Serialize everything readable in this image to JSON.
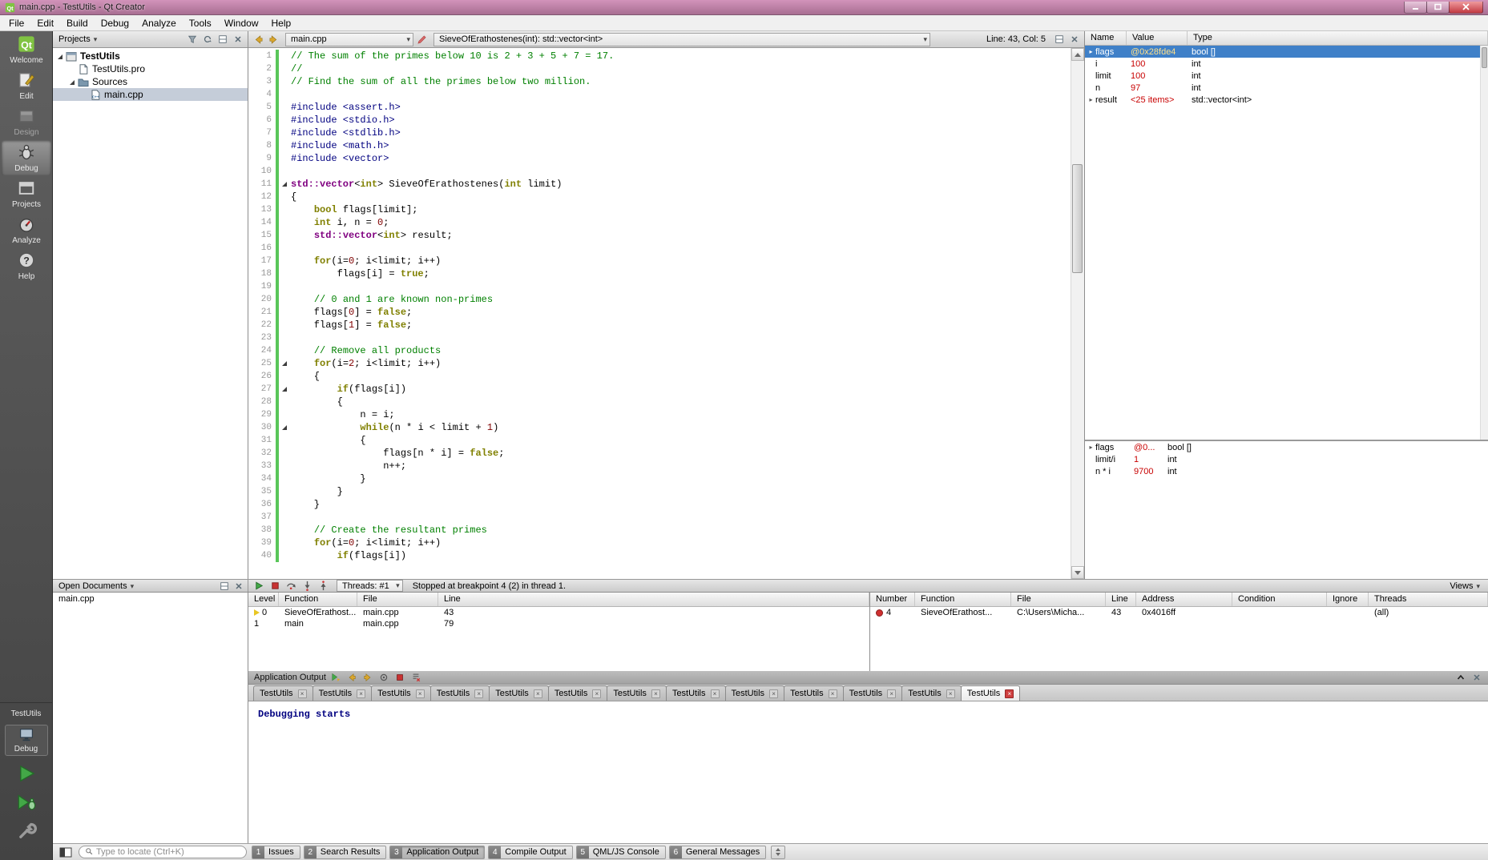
{
  "window": {
    "title": "main.cpp - TestUtils - Qt Creator"
  },
  "menubar": [
    "File",
    "Edit",
    "Build",
    "Debug",
    "Analyze",
    "Tools",
    "Window",
    "Help"
  ],
  "mode_sidebar": {
    "modes": [
      {
        "label": "Welcome",
        "icon": "qtlogo",
        "active": false,
        "disabled": false
      },
      {
        "label": "Edit",
        "icon": "edit",
        "active": false,
        "disabled": false
      },
      {
        "label": "Design",
        "icon": "design",
        "active": false,
        "disabled": true
      },
      {
        "label": "Debug",
        "icon": "debug",
        "active": true,
        "disabled": false
      },
      {
        "label": "Projects",
        "icon": "projects",
        "active": false,
        "disabled": false
      },
      {
        "label": "Analyze",
        "icon": "analyze",
        "active": false,
        "disabled": false
      },
      {
        "label": "Help",
        "icon": "help",
        "active": false,
        "disabled": false
      }
    ],
    "target_name": "TestUtils",
    "build_config": "Debug"
  },
  "projects_panel": {
    "title": "Projects",
    "tree": [
      {
        "label": "TestUtils",
        "depth": 0,
        "bold": true,
        "expanded": true,
        "icon": "project",
        "selected": false
      },
      {
        "label": "TestUtils.pro",
        "depth": 1,
        "icon": "profile",
        "selected": false
      },
      {
        "label": "Sources",
        "depth": 1,
        "expanded": true,
        "icon": "folder",
        "selected": false
      },
      {
        "label": "main.cpp",
        "depth": 2,
        "icon": "cppfile",
        "selected": true
      }
    ]
  },
  "editor": {
    "file_combo": "main.cpp",
    "symbol_combo": "SieveOfErathostenes(int): std::vector<int>",
    "line_col": "Line: 43, Col: 5",
    "fold_lines": [
      11,
      25,
      27,
      30
    ],
    "code_lines": [
      "// The sum of the primes below 10 is 2 + 3 + 5 + 7 = 17.",
      "//",
      "// Find the sum of all the primes below two million.",
      "",
      "#include <assert.h>",
      "#include <stdio.h>",
      "#include <stdlib.h>",
      "#include <math.h>",
      "#include <vector>",
      "",
      "std::vector<int> SieveOfErathostenes(int limit)",
      "{",
      "    bool flags[limit];",
      "    int i, n = 0;",
      "    std::vector<int> result;",
      "",
      "    for(i=0; i<limit; i++)",
      "        flags[i] = true;",
      "",
      "    // 0 and 1 are known non-primes",
      "    flags[0] = false;",
      "    flags[1] = false;",
      "",
      "    // Remove all products",
      "    for(i=2; i<limit; i++)",
      "    {",
      "        if(flags[i])",
      "        {",
      "            n = i;",
      "            while(n * i < limit + 1)",
      "            {",
      "                flags[n * i] = false;",
      "                n++;",
      "            }",
      "        }",
      "    }",
      "",
      "    // Create the resultant primes",
      "    for(i=0; i<limit; i++)",
      "        if(flags[i])"
    ]
  },
  "locals_pane": {
    "columns": [
      "Name",
      "Value",
      "Type"
    ],
    "rows": [
      {
        "name": "flags",
        "value": "@0x28fde4",
        "type": "bool []",
        "selected": true,
        "expandable": true
      },
      {
        "name": "i",
        "value": "100",
        "type": "int",
        "selected": false,
        "expandable": false
      },
      {
        "name": "limit",
        "value": "100",
        "type": "int",
        "selected": false,
        "expandable": false
      },
      {
        "name": "n",
        "value": "97",
        "type": "int",
        "selected": false,
        "expandable": false
      },
      {
        "name": "result",
        "value": "<25 items>",
        "type": "std::vector<int>",
        "selected": false,
        "expandable": true
      }
    ]
  },
  "watch_pane": {
    "rows": [
      {
        "name": "flags",
        "value": "@0...",
        "type": "bool []",
        "selected": false,
        "expandable": true
      },
      {
        "name": "limit/i",
        "value": "1",
        "type": "int",
        "selected": false,
        "expandable": false
      },
      {
        "name": "n * i",
        "value": "9700",
        "type": "int",
        "selected": false,
        "expandable": false
      }
    ]
  },
  "debug_toolbar": {
    "threads_label": "Threads: #1",
    "status": "Stopped at breakpoint 4 (2) in thread 1.",
    "views_label": "Views"
  },
  "open_documents": {
    "title": "Open Documents",
    "items": [
      "main.cpp"
    ]
  },
  "stack_pane": {
    "columns": [
      "Level",
      "Function",
      "File",
      "Line"
    ],
    "rows": [
      {
        "cells": [
          "0",
          "SieveOfErathost...",
          "main.cpp",
          "43"
        ],
        "current": true
      },
      {
        "cells": [
          "1",
          "main",
          "main.cpp",
          "79"
        ],
        "current": false
      }
    ]
  },
  "breakpoints_pane": {
    "columns": [
      "Number",
      "Function",
      "File",
      "Line",
      "Address",
      "Condition",
      "Ignore",
      "Threads"
    ],
    "rows": [
      {
        "cells": [
          "4",
          "SieveOfErathost...",
          "C:\\Users\\Micha...",
          "43",
          "0x4016ff",
          "",
          "",
          "(all)"
        ],
        "breakpoint": true
      }
    ]
  },
  "output_pane": {
    "title": "Application Output",
    "tabs": [
      "TestUtils",
      "TestUtils",
      "TestUtils",
      "TestUtils",
      "TestUtils",
      "TestUtils",
      "TestUtils",
      "TestUtils",
      "TestUtils",
      "TestUtils",
      "TestUtils",
      "TestUtils",
      "TestUtils"
    ],
    "active_tab": 12,
    "content": "Debugging starts"
  },
  "status_bar": {
    "locate_placeholder": "Type to locate (Ctrl+K)",
    "buttons": [
      {
        "num": "1",
        "label": "Issues",
        "active": false
      },
      {
        "num": "2",
        "label": "Search Results",
        "active": false
      },
      {
        "num": "3",
        "label": "Application Output",
        "active": true
      },
      {
        "num": "4",
        "label": "Compile Output",
        "active": false
      },
      {
        "num": "5",
        "label": "QML/JS Console",
        "active": false
      },
      {
        "num": "6",
        "label": "General Messages",
        "active": false
      }
    ]
  },
  "colors": {
    "titlebar_top": "#d293ba",
    "titlebar_bottom": "#a86e92",
    "selection_blue": "#3f80c8",
    "changed_value_red": "#c80000",
    "comment_green": "#008000",
    "preproc_navy": "#000080",
    "keyword_olive": "#808000",
    "type_purple": "#800080",
    "number_maroon": "#800000",
    "change_bar_green": "#59c659",
    "breakpoint_red": "#cf3030",
    "current_frame_yellow": "#e8c623",
    "run_green": "#43a847",
    "stop_red": "#c83232",
    "output_text_navy": "#000080"
  }
}
